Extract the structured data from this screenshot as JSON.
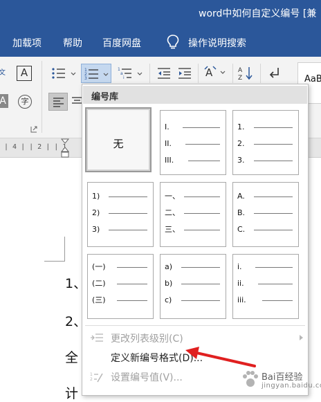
{
  "window": {
    "title": "word中如何自定义编号 [兼"
  },
  "menu_bar": {
    "items": [
      "加载项",
      "帮助",
      "百度网盘",
      "操作说明搜索"
    ]
  },
  "ribbon": {
    "font_label": "文",
    "style_preview": "AaB",
    "ruler_marks": "| 4 |  | 2 |  | 1",
    "hanzi_circle": "字"
  },
  "numbering_library": {
    "header": "编号库",
    "none_label": "无",
    "formats": [
      {
        "name": "roman",
        "markers": [
          "I.",
          "II.",
          "III."
        ]
      },
      {
        "name": "arabic-dot",
        "markers": [
          "1.",
          "2.",
          "3."
        ]
      },
      {
        "name": "arabic-paren",
        "markers": [
          "1)",
          "2)",
          "3)"
        ]
      },
      {
        "name": "chinese",
        "markers": [
          "一、",
          "二、",
          "三、"
        ]
      },
      {
        "name": "upper-alpha",
        "markers": [
          "A.",
          "B.",
          "C."
        ]
      },
      {
        "name": "chinese-paren",
        "markers": [
          "(一)",
          "(二)",
          "(三)"
        ]
      },
      {
        "name": "lower-alpha-paren",
        "markers": [
          "a)",
          "b)",
          "c)"
        ]
      },
      {
        "name": "lower-roman",
        "markers": [
          "i.",
          "ii.",
          "iii."
        ]
      }
    ]
  },
  "menu_items": {
    "change_level": "更改列表级别(C)",
    "define_format": "定义新编号格式(D)...",
    "set_value": "设置编号值(V)..."
  },
  "document": {
    "lines": [
      "1、",
      "2、",
      "全",
      "计"
    ]
  },
  "watermark": {
    "text": "Bai百经验",
    "sub": "jingyan.baidu.com"
  },
  "colors": {
    "titlebar": "#2b579a",
    "accent_arrow": "#e02020"
  }
}
